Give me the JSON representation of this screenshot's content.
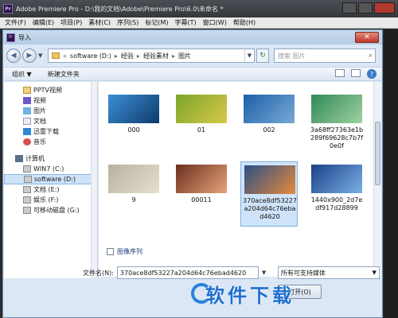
{
  "app": {
    "title": "Adobe Premiere Pro - D:\\我的文档\\Adobe\\Premiere Pro\\6.0\\未命名 *",
    "logo": "Pr",
    "menu": [
      "文件(F)",
      "编辑(E)",
      "项目(P)",
      "素材(C)",
      "序列(S)",
      "标记(M)",
      "字幕(T)",
      "窗口(W)",
      "帮助(H)"
    ]
  },
  "dialog": {
    "title": "导入",
    "close_label": "✕",
    "path": [
      "software (D:)",
      "经验",
      "经验素材",
      "图片"
    ],
    "search_placeholder": "搜索 图片",
    "toolbar": {
      "organize": "组织 ▼",
      "new_folder": "新建文件夹"
    },
    "sidebar": {
      "library": [
        {
          "label": "PPTV视频",
          "icon": "pptv-icon"
        },
        {
          "label": "视频",
          "icon": "video-library-icon"
        },
        {
          "label": "图片",
          "icon": "picture-library-icon"
        },
        {
          "label": "文档",
          "icon": "document-library-icon"
        },
        {
          "label": "迅雷下载",
          "icon": "download-icon"
        },
        {
          "label": "音乐",
          "icon": "music-icon"
        }
      ],
      "computer_label": "计算机",
      "drives": [
        {
          "label": "WIN7 (C:)",
          "selected": false
        },
        {
          "label": "software (D:)",
          "selected": true
        },
        {
          "label": "文档 (E:)",
          "selected": false
        },
        {
          "label": "娱乐 (F:)",
          "selected": false
        },
        {
          "label": "可移动磁盘 (G:)",
          "selected": false
        }
      ]
    },
    "files": [
      {
        "name": "000",
        "thumb": [
          "#3b8fd6",
          "#0e3b6a"
        ]
      },
      {
        "name": "01",
        "thumb": [
          "#7ba52a",
          "#d8c84a"
        ]
      },
      {
        "name": "002",
        "thumb": [
          "#1d5fa8",
          "#78aad6"
        ]
      },
      {
        "name": "3a68ff27363e1b289f69628c7b7f0e0f",
        "thumb": [
          "#2f8a56",
          "#9fd0a0"
        ]
      },
      {
        "name": "9",
        "thumb": [
          "#b9b09f",
          "#e6e0d2"
        ]
      },
      {
        "name": "00011",
        "thumb": [
          "#6a2f1e",
          "#e7a37a"
        ]
      },
      {
        "name": "370ace8df53227a204d64c76ebad4620",
        "thumb": [
          "#2c4f86",
          "#e68a3a"
        ],
        "selected": true
      },
      {
        "name": "1440x900_2d7edf917d28899",
        "thumb": [
          "#1b3f86",
          "#7ab0e6"
        ]
      }
    ],
    "image_sequence_label": "图像序列",
    "filename_label": "文件名(N):",
    "filename_value": "370ace8df53227a204d64c76ebad4620",
    "filter_value": "所有可支持媒体",
    "open_button": "打开(O)"
  },
  "watermark": "软件下载",
  "colors": {
    "accent": "#1f6fd0",
    "selection": "#cfe4fa",
    "dialog_bg": "#dbe7f4"
  }
}
